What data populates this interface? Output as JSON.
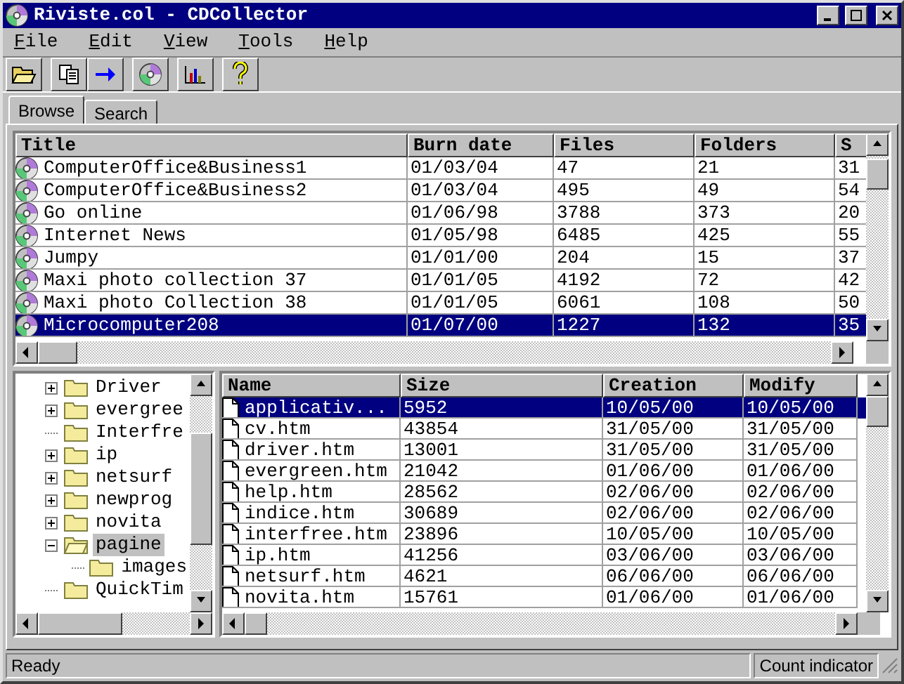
{
  "window": {
    "title": "Riviste.col - CDCollector"
  },
  "menu": [
    {
      "label": "File"
    },
    {
      "label": "Edit"
    },
    {
      "label": "View"
    },
    {
      "label": "Tools"
    },
    {
      "label": "Help"
    }
  ],
  "toolbar": [
    {
      "buttons": [
        {
          "kind": "open"
        }
      ]
    },
    {
      "buttons": [
        {
          "kind": "copy"
        },
        {
          "kind": "arrow"
        }
      ]
    },
    {
      "buttons": [
        {
          "kind": "disc"
        }
      ]
    },
    {
      "buttons": [
        {
          "kind": "chart"
        }
      ]
    },
    {
      "buttons": [
        {
          "kind": "help"
        }
      ]
    }
  ],
  "tabs": [
    {
      "label": "Browse",
      "selected": true
    },
    {
      "label": "Search",
      "selected": false
    }
  ],
  "collections": {
    "columns": [
      "Title",
      "Burn date",
      "Files",
      "Folders",
      "S"
    ],
    "rows": [
      {
        "cells": [
          "ComputerOffice&Business1",
          "01/03/04",
          "47",
          "21",
          "31"
        ],
        "selected": false
      },
      {
        "cells": [
          "ComputerOffice&Business2",
          "01/03/04",
          "495",
          "49",
          "54"
        ],
        "selected": false
      },
      {
        "cells": [
          "Go online",
          "01/06/98",
          "3788",
          "373",
          "20"
        ],
        "selected": false
      },
      {
        "cells": [
          "Internet News",
          "01/05/98",
          "6485",
          "425",
          "55"
        ],
        "selected": false
      },
      {
        "cells": [
          "Jumpy",
          "01/01/00",
          "204",
          "15",
          "37"
        ],
        "selected": false
      },
      {
        "cells": [
          "Maxi photo collection 37",
          "01/01/05",
          "4192",
          "72",
          "42"
        ],
        "selected": false
      },
      {
        "cells": [
          "Maxi photo Collection 38",
          "01/01/05",
          "6061",
          "108",
          "50"
        ],
        "selected": false
      },
      {
        "cells": [
          "Microcomputer208",
          "01/07/00",
          "1227",
          "132",
          "35"
        ],
        "selected": true
      }
    ]
  },
  "tree": {
    "items": [
      {
        "label": "Driver",
        "kind": "branch",
        "expanded": false,
        "selected": false
      },
      {
        "label": "evergree",
        "kind": "branch",
        "expanded": false,
        "selected": false
      },
      {
        "label": "Interfre",
        "kind": "leaf",
        "expanded": false,
        "selected": false
      },
      {
        "label": "ip",
        "kind": "branch",
        "expanded": false,
        "selected": false
      },
      {
        "label": "netsurf",
        "kind": "branch",
        "expanded": false,
        "selected": false
      },
      {
        "label": "newprog",
        "kind": "branch",
        "expanded": false,
        "selected": false
      },
      {
        "label": "novita",
        "kind": "branch",
        "expanded": false,
        "selected": false
      },
      {
        "label": "pagine",
        "kind": "branch",
        "expanded": true,
        "selected": true,
        "children": [
          {
            "label": "images",
            "kind": "leaf",
            "expanded": false,
            "selected": false
          }
        ]
      },
      {
        "label": "QuickTim",
        "kind": "leaf",
        "expanded": false,
        "selected": false
      }
    ]
  },
  "files": {
    "columns": [
      "Name",
      "Size",
      "Creation",
      "Modify"
    ],
    "rows": [
      {
        "cells": [
          "applicativ...",
          "5952",
          "10/05/00",
          "10/05/00"
        ],
        "selected": true
      },
      {
        "cells": [
          "cv.htm",
          "43854",
          "31/05/00",
          "31/05/00"
        ],
        "selected": false
      },
      {
        "cells": [
          "driver.htm",
          "13001",
          "31/05/00",
          "31/05/00"
        ],
        "selected": false
      },
      {
        "cells": [
          "evergreen.htm",
          "21042",
          "01/06/00",
          "01/06/00"
        ],
        "selected": false
      },
      {
        "cells": [
          "help.htm",
          "28562",
          "02/06/00",
          "02/06/00"
        ],
        "selected": false
      },
      {
        "cells": [
          "indice.htm",
          "30689",
          "02/06/00",
          "02/06/00"
        ],
        "selected": false
      },
      {
        "cells": [
          "interfree.htm",
          "23896",
          "10/05/00",
          "10/05/00"
        ],
        "selected": false
      },
      {
        "cells": [
          "ip.htm",
          "41256",
          "03/06/00",
          "03/06/00"
        ],
        "selected": false
      },
      {
        "cells": [
          "netsurf.htm",
          "4621",
          "06/06/00",
          "06/06/00"
        ],
        "selected": false
      },
      {
        "cells": [
          "novita.htm",
          "15761",
          "01/06/00",
          "01/06/00"
        ],
        "selected": false
      }
    ]
  },
  "status_bar": {
    "text": "Ready",
    "indicator": "Count indicator"
  }
}
